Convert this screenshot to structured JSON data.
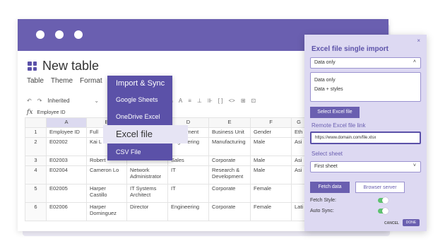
{
  "window": {
    "title": "New table"
  },
  "menubar": {
    "items": [
      "Table",
      "Theme",
      "Format"
    ]
  },
  "toolbar": {
    "select_value": "Inherited"
  },
  "formula_bar": {
    "fx": "fx",
    "value": "Employee ID"
  },
  "sheet": {
    "columns": [
      "",
      "A",
      "B",
      "C",
      "D",
      "E",
      "F",
      "G"
    ],
    "rows": [
      [
        "1",
        "Employee ID",
        "Full",
        "",
        "Department",
        "Business Unit",
        "Gender",
        "Eth"
      ],
      [
        "2",
        "E02002",
        "Kai L",
        "",
        "Engineering",
        "Manufacturing",
        "Male",
        "Asi"
      ],
      [
        "3",
        "E02003",
        "Robert",
        "",
        "Sales",
        "Corporate",
        "Male",
        "Asi"
      ],
      [
        "4",
        "E02004",
        "Cameron Lo",
        "Network Administrator",
        "IT",
        "Research & Development",
        "Male",
        "Asi"
      ],
      [
        "5",
        "E02005",
        "Harper Castillo",
        "IT Systems Architect",
        "IT",
        "Corporate",
        "Female",
        ""
      ],
      [
        "6",
        "E02006",
        "Harper Dominguez",
        "Director",
        "Engineering",
        "Corporate",
        "Female",
        "Lati"
      ]
    ]
  },
  "import_menu": {
    "header": "Import & Sync",
    "items": [
      "Google Sheets",
      "OneDrive Excel",
      "Excel file",
      "CSV File"
    ]
  },
  "panel": {
    "close": "×",
    "title": "Excel file single import",
    "mode_value": "Data only",
    "mode_options": [
      "Data only",
      "Data + styles"
    ],
    "select_file_button": "Select Excel file",
    "remote_label": "Remote Excel file link",
    "remote_value": "https://www.domain.com/file.xlsx",
    "sheet_label": "Select sheet",
    "sheet_value": "First sheet",
    "fetch_button": "Fetch data",
    "browser_server_button": "Browser server",
    "fetch_style_label": "Fetch Style:",
    "auto_sync_label": "Auto Sync:",
    "cancel": "CANCEL",
    "done": "DONE",
    "fetch_style_on": true,
    "auto_sync_on": true
  }
}
